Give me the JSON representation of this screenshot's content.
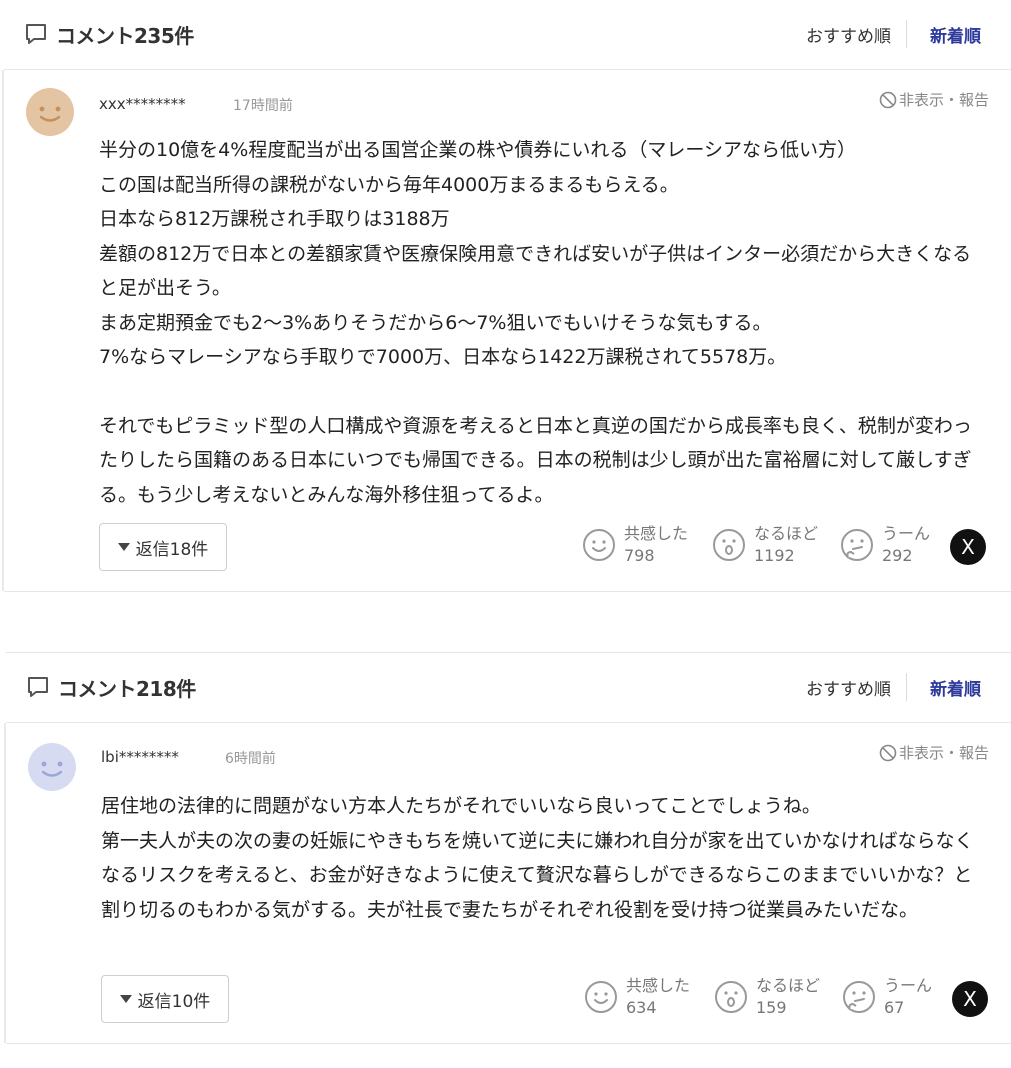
{
  "threads": [
    {
      "header": {
        "title": "コメント235件",
        "sort_recommended": "おすすめ順",
        "sort_newest": "新着順"
      },
      "comment": {
        "user": "xxx********",
        "time": "17時間前",
        "report": "非表示・報告",
        "lines": [
          "半分の10億を4%程度配当が出る国営企業の株や債券にいれる（マレーシアなら低い方）",
          "この国は配当所得の課税がないから毎年4000万まるまるもらえる。",
          "日本なら812万課税され手取りは3188万",
          "差額の812万で日本との差額家賃や医療保険用意できれば安いが子供はインター必須だから大きくなると足が出そう。",
          "まあ定期預金でも2〜3%ありそうだから6〜7%狙いでもいけそうな気もする。",
          "7%ならマレーシアなら手取りで7000万、日本なら1422万課税されて5578万。",
          "",
          "それでもピラミッド型の人口構成や資源を考えると日本と真逆の国だから成長率も良く、税制が変わったりしたら国籍のある日本にいつでも帰国できる。日本の税制は少し頭が出た富裕層に対して厳しすぎる。もう少し考えないとみんな海外移住狙ってるよ。"
        ],
        "reply_label": "返信18件",
        "reactions": [
          {
            "label": "共感した",
            "count": "798"
          },
          {
            "label": "なるほど",
            "count": "1192"
          },
          {
            "label": "うーん",
            "count": "292"
          }
        ],
        "share_label": "X",
        "avatar_color": "#e3c4a3"
      }
    },
    {
      "header": {
        "title": "コメント218件",
        "sort_recommended": "おすすめ順",
        "sort_newest": "新着順"
      },
      "comment": {
        "user": "lbi********",
        "time": "6時間前",
        "report": "非表示・報告",
        "lines": [
          "居住地の法律的に問題がない方本人たちがそれでいいなら良いってことでしょうね。",
          "第一夫人が夫の次の妻の妊娠にやきもちを焼いて逆に夫に嫌われ自分が家を出ていかなければならなくなるリスクを考えると、お金が好きなように使えて贅沢な暮らしができるならこのままでいいかな？と割り切るのもわかる気がする。夫が社長で妻たちがそれぞれ役割を受け持つ従業員みたいだな。"
        ],
        "reply_label": "返信10件",
        "reactions": [
          {
            "label": "共感した",
            "count": "634"
          },
          {
            "label": "なるほど",
            "count": "159"
          },
          {
            "label": "うーん",
            "count": "67"
          }
        ],
        "share_label": "X",
        "avatar_color": "#d6dbf1"
      }
    }
  ]
}
